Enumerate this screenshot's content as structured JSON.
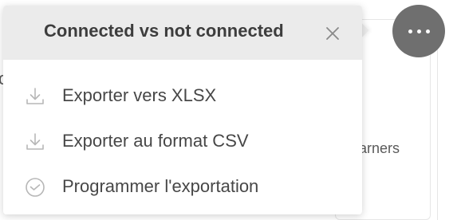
{
  "popover": {
    "title": "Connected vs not connected",
    "close_icon": "close-icon",
    "items": [
      {
        "label": "Exporter vers XLSX",
        "icon": "download-icon"
      },
      {
        "label": "Exporter au format CSV",
        "icon": "download-icon"
      },
      {
        "label": "Programmer l'exportation",
        "icon": "clock-icon"
      }
    ]
  },
  "more_button": {
    "icon": "more-horizontal-icon",
    "color": "#6f6f6f"
  },
  "background": {
    "left_fragment": "c",
    "right_fragment": "earners"
  },
  "colors": {
    "header_bg": "#ebebeb",
    "text": "#474747",
    "icon": "#b7b7b7"
  }
}
